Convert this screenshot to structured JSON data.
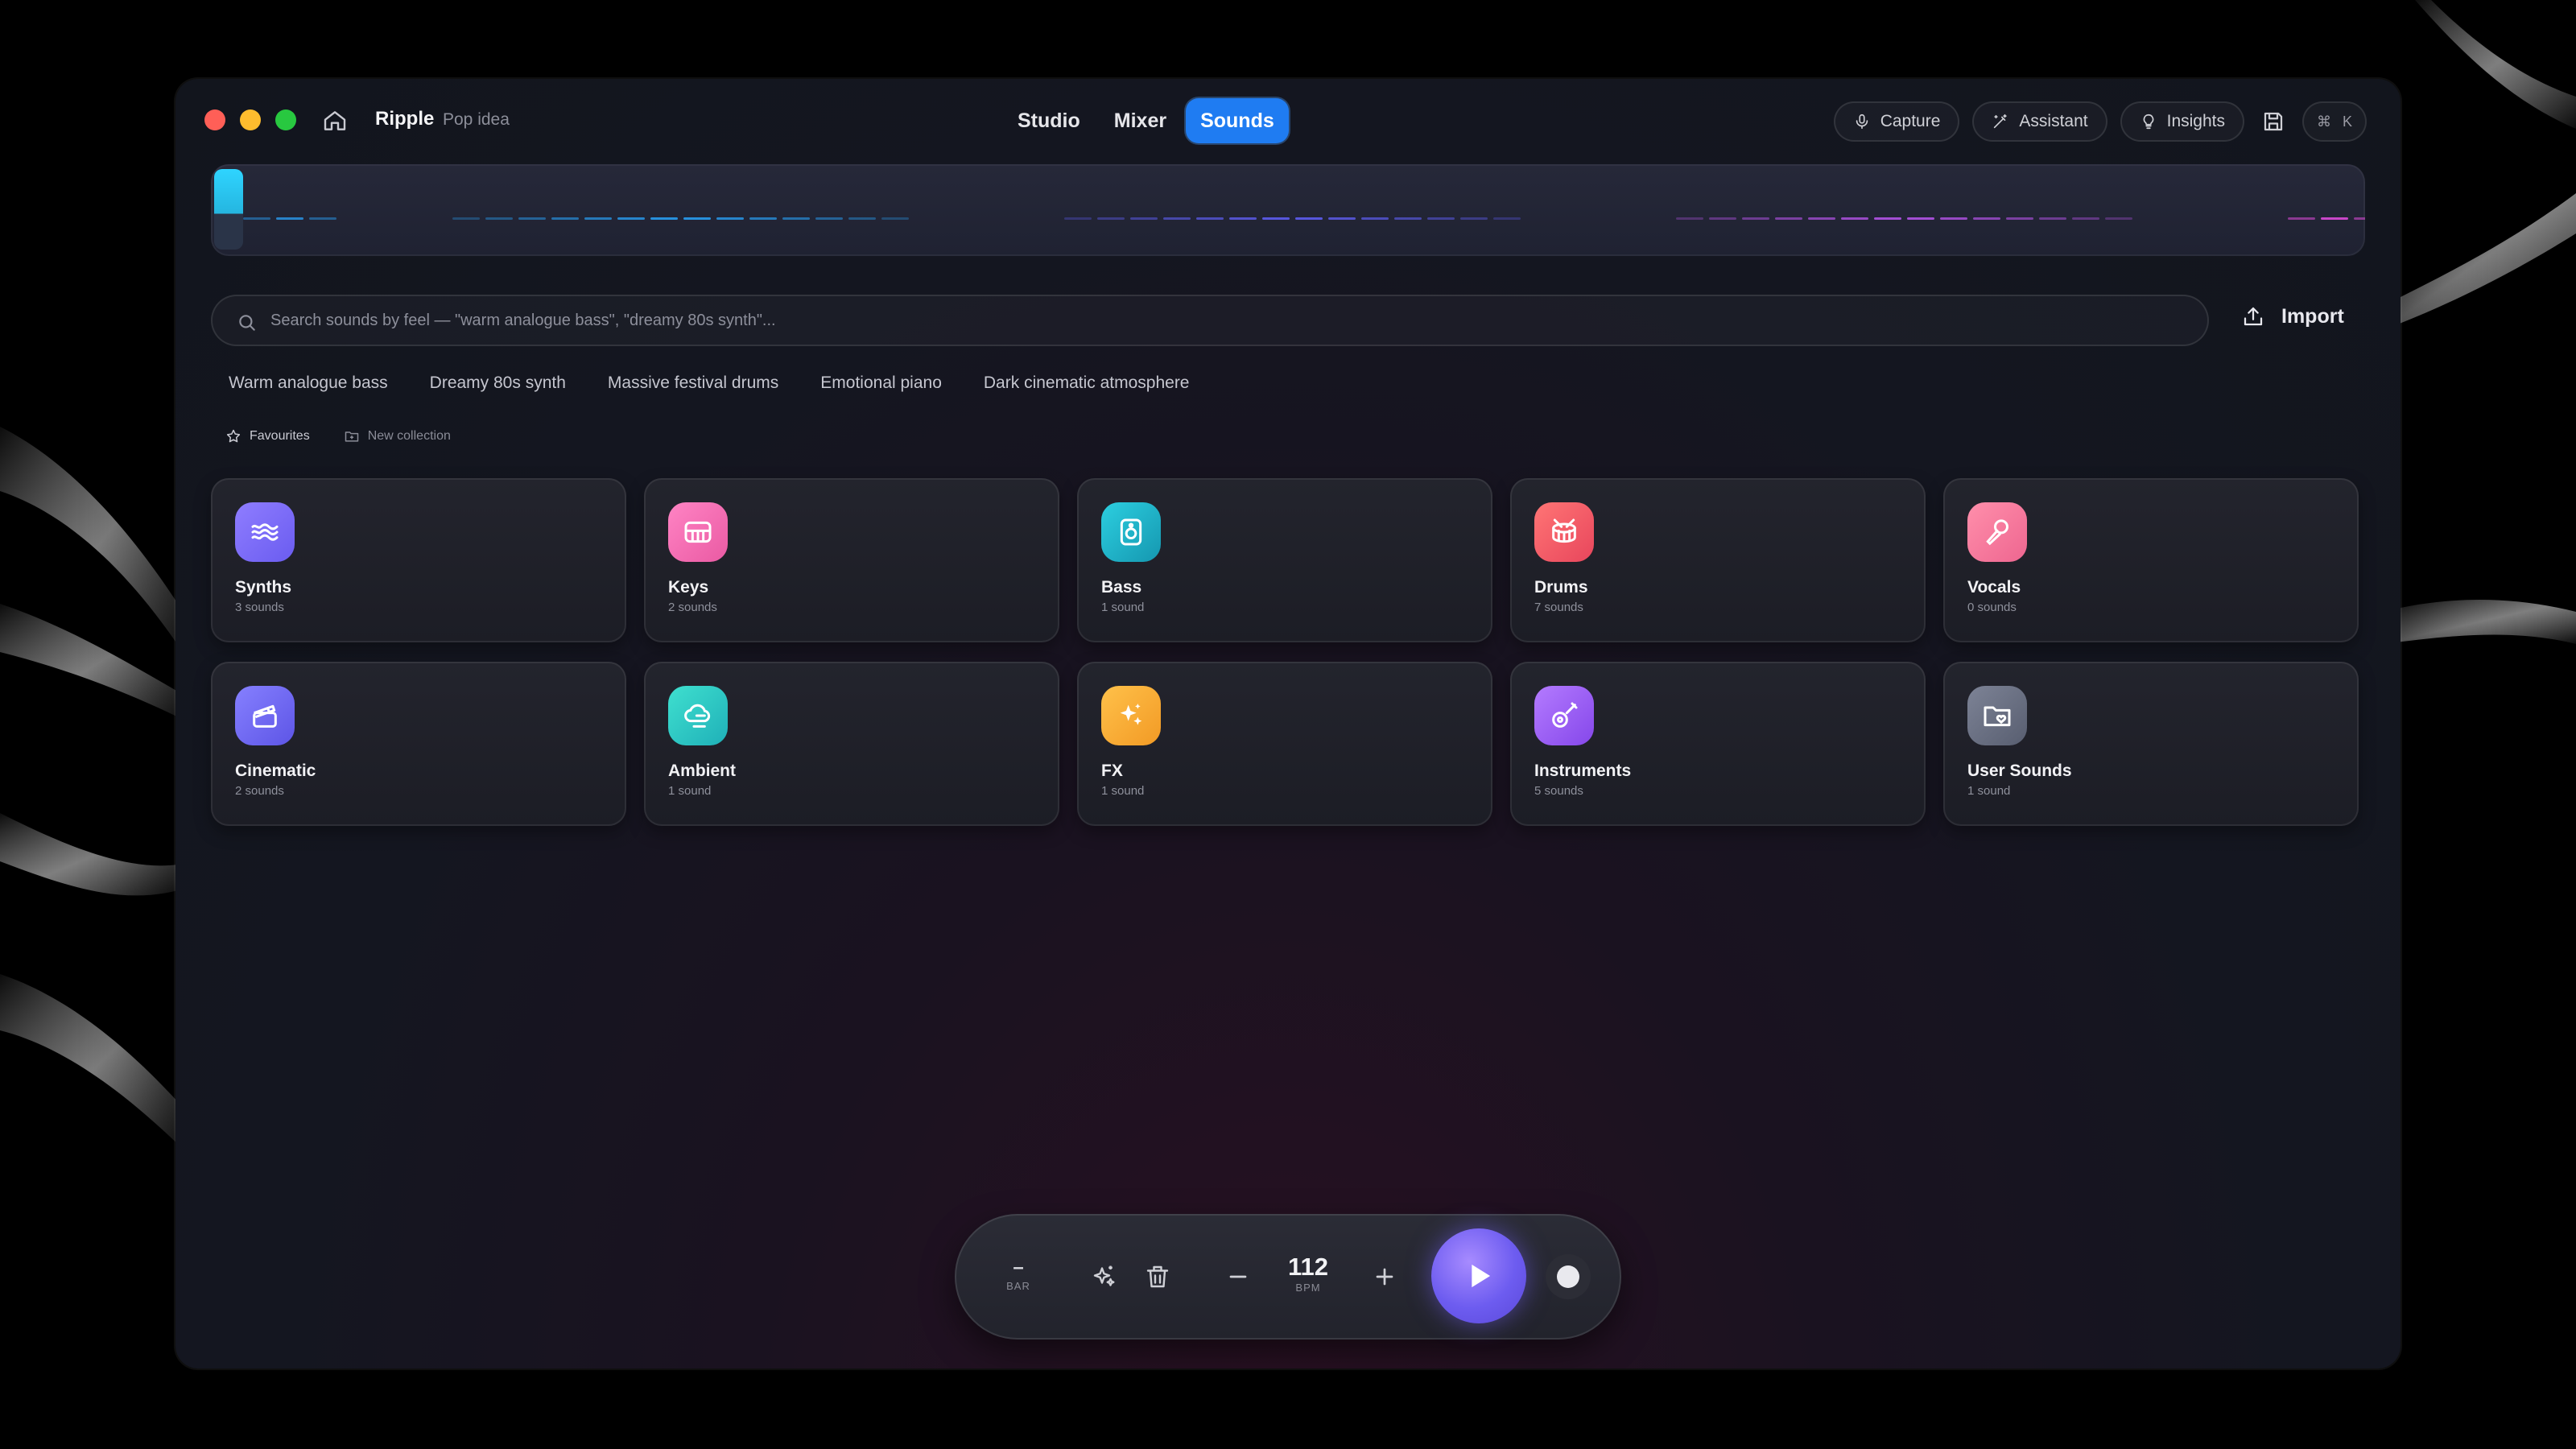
{
  "app": {
    "title": "Ripple",
    "project": "Pop idea"
  },
  "tabs": [
    {
      "label": "Studio",
      "active": false
    },
    {
      "label": "Mixer",
      "active": false
    },
    {
      "label": "Sounds",
      "active": true
    }
  ],
  "toolbar": {
    "capture": "Capture",
    "assistant": "Assistant",
    "insights": "Insights",
    "shortcut_mod": "⌘",
    "shortcut_key": "K"
  },
  "search": {
    "placeholder": "Search sounds by feel — \"warm analogue bass\", \"dreamy 80s synth\"...",
    "import_label": "Import"
  },
  "suggestions": [
    "Warm analogue bass",
    "Dreamy 80s synth",
    "Massive festival drums",
    "Emotional piano",
    "Dark cinematic atmosphere"
  ],
  "collections": {
    "favourites": "Favourites",
    "new_collection": "New collection"
  },
  "categories": [
    {
      "name": "Synths",
      "count": "3 sounds",
      "icon": "waves-icon",
      "color": "#7b6cf6"
    },
    {
      "name": "Keys",
      "count": "2 sounds",
      "icon": "piano-icon",
      "color": "#f26bb0"
    },
    {
      "name": "Bass",
      "count": "1 sound",
      "icon": "speaker-icon",
      "color": "#1fb8c9"
    },
    {
      "name": "Drums",
      "count": "7 sounds",
      "icon": "drum-icon",
      "color": "#f2596a"
    },
    {
      "name": "Vocals",
      "count": "0 sounds",
      "icon": "microphone-icon",
      "color": "#f0739a"
    },
    {
      "name": "Cinematic",
      "count": "2 sounds",
      "icon": "clapperboard-icon",
      "color": "#6f67f0"
    },
    {
      "name": "Ambient",
      "count": "1 sound",
      "icon": "cloud-icon",
      "color": "#2cc7c3"
    },
    {
      "name": "FX",
      "count": "1 sound",
      "icon": "sparkles-icon",
      "color": "#f5a431"
    },
    {
      "name": "Instruments",
      "count": "5 sounds",
      "icon": "guitar-icon",
      "color": "#9b5cf0"
    },
    {
      "name": "User Sounds",
      "count": "1 sound",
      "icon": "folder-heart-icon",
      "color": "#6c7284"
    }
  ],
  "transport": {
    "bar_value": "–",
    "bar_label": "BAR",
    "bpm_value": "112",
    "bpm_label": "BPM"
  },
  "colors": {
    "accent": "#1f7cf2",
    "playhead": "#2fd4ff",
    "play": "#6d5cf0"
  }
}
